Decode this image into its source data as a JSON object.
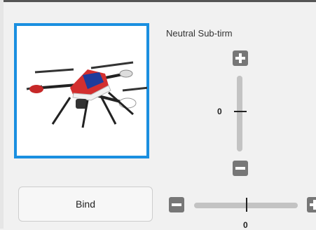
{
  "subtrim": {
    "title": "Neutral Sub-tirm",
    "vertical_value": "0",
    "horizontal_value": "0"
  },
  "bind": {
    "label": "Bind"
  },
  "icons": {
    "increase": "plus-icon",
    "decrease": "minus-icon",
    "model": "drone-image"
  },
  "colors": {
    "selected_border": "#1a8fe0",
    "button_gray": "#777777"
  }
}
